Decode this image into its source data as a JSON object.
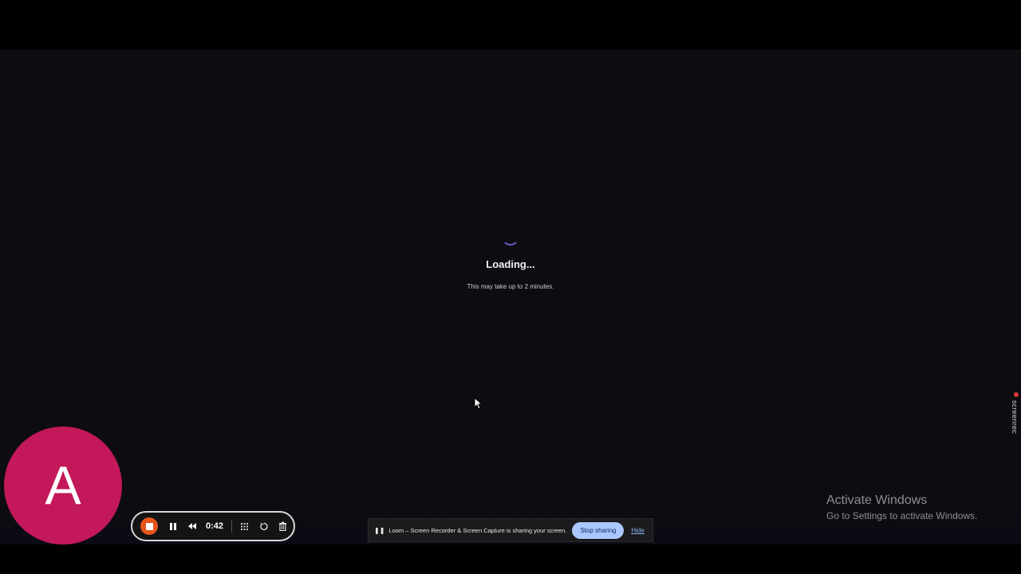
{
  "loading": {
    "title": "Loading...",
    "subtitle": "This may take up to 2 minutes."
  },
  "screenrec": {
    "label": "screenrec"
  },
  "avatar": {
    "initial": "A",
    "color": "#c3185a"
  },
  "recorder": {
    "time": "0:42",
    "icons": [
      "stop-icon",
      "pause-icon",
      "rewind-icon",
      "grid-icon",
      "restart-icon",
      "trash-icon"
    ],
    "accent": "#e8551a"
  },
  "share_bar": {
    "message": "Loom – Screen Recorder & Screen Capture is sharing your screen.",
    "stop_label": "Stop sharing",
    "hide_label": "Hide"
  },
  "watermark": {
    "title": "Activate Windows",
    "subtitle": "Go to Settings to activate Windows."
  }
}
